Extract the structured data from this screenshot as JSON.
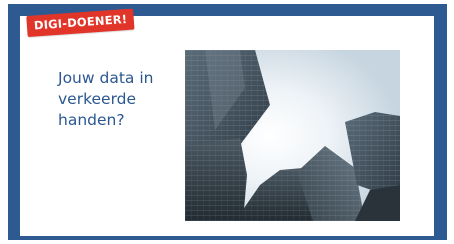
{
  "badge": {
    "text": "DIGI-DOENER!"
  },
  "headline": {
    "text": "Jouw data in verkeerde handen?"
  },
  "photo": {
    "alt": "Kantoortorens van onderaf"
  },
  "colors": {
    "frame": "#2c5a91",
    "accent": "#e2352a",
    "text": "#2b5791"
  }
}
